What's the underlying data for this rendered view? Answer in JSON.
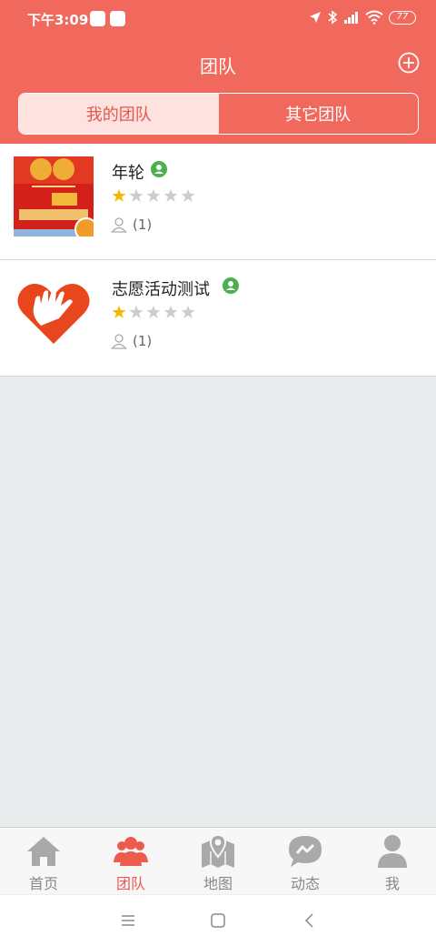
{
  "status_bar": {
    "time": "下午3:09",
    "battery": "77"
  },
  "header": {
    "title": "团队",
    "add_icon": "plus-circle-icon"
  },
  "segment": {
    "tabs": [
      {
        "label": "我的团队",
        "active": true
      },
      {
        "label": "其它团队",
        "active": false
      }
    ]
  },
  "teams": [
    {
      "name": "年轮",
      "verified": true,
      "rating": 1,
      "max_rating": 5,
      "members": "(1)"
    },
    {
      "name": "志愿活动测试",
      "verified": true,
      "rating": 1,
      "max_rating": 5,
      "members": "(1)"
    }
  ],
  "tabbar": {
    "tabs": [
      {
        "label": "首页",
        "icon": "home-icon",
        "active": false
      },
      {
        "label": "团队",
        "icon": "team-icon",
        "active": true
      },
      {
        "label": "地图",
        "icon": "map-icon",
        "active": false
      },
      {
        "label": "动态",
        "icon": "message-icon",
        "active": false
      },
      {
        "label": "我",
        "icon": "user-icon",
        "active": false
      }
    ]
  },
  "colors": {
    "accent": "#f0695c",
    "active_tab": "#ee5a4e",
    "star_filled": "#f5b800",
    "star_empty": "#cccccc",
    "verified": "#4caf50"
  }
}
